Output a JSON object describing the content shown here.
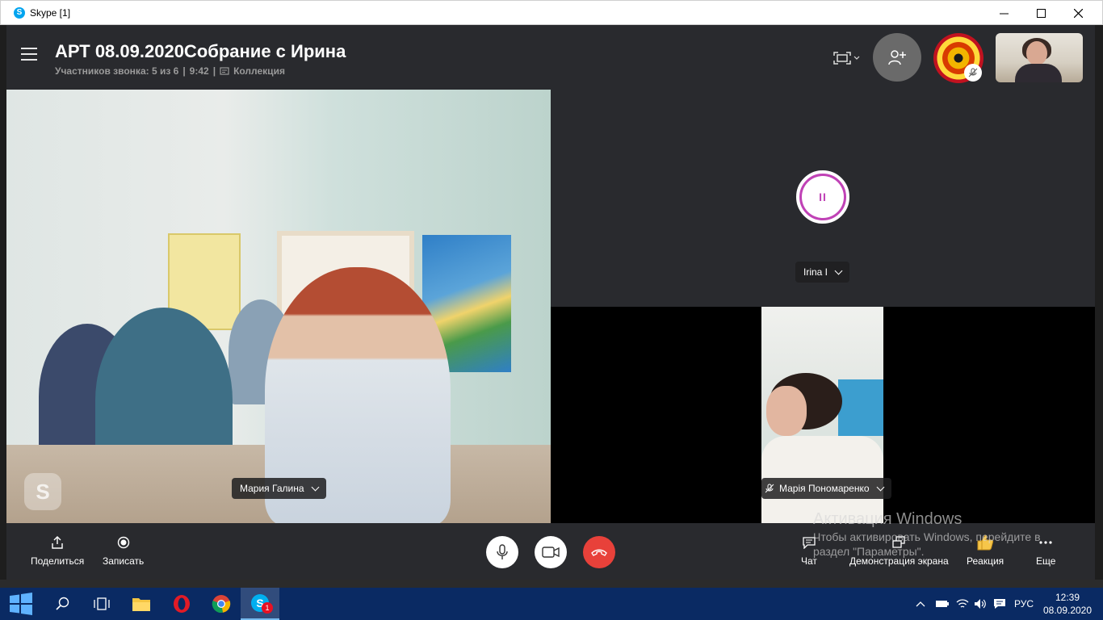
{
  "window": {
    "title": "Skype [1]",
    "app_icon_letter": "S"
  },
  "header": {
    "call_title": "АРТ 08.09.2020Собрание с Ирина",
    "participants": "Участников звонка: 5 из 6",
    "separator": "|",
    "duration": "9:42",
    "collection": "Коллекция"
  },
  "tiles": {
    "main_name": "Мария Галина",
    "speaker_name": "Irina I",
    "speaker_status": "II",
    "small_name": "Марія Пономаренко",
    "watermark_letter": "S"
  },
  "controls": {
    "share": "Поделиться",
    "record": "Записать",
    "chat": "Чат",
    "screen_share": "Демонстрация экрана",
    "reaction": "Реакция",
    "more": "Еще",
    "end_call_color": "#e8413a",
    "avatar_ring_color": "#c042b6"
  },
  "activation": {
    "line1": "Активация Windows",
    "line2": "Чтобы активировать Windows, перейдите в",
    "line3": "раздел \"Параметры\"."
  },
  "taskbar": {
    "language": "РУС",
    "time": "12:39",
    "date": "08.09.2020",
    "skype_badge": "1"
  }
}
